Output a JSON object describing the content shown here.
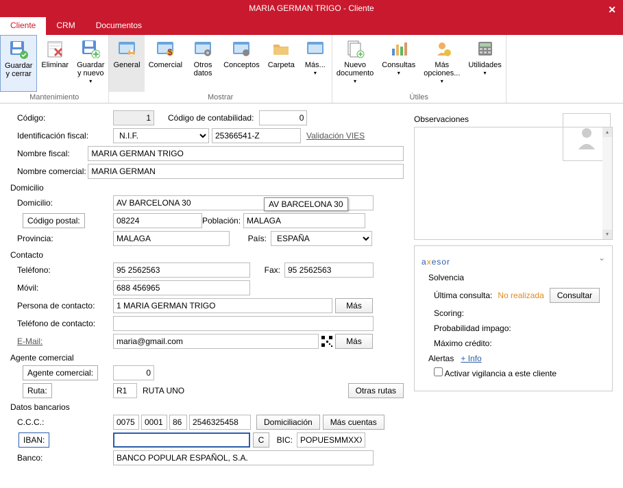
{
  "window": {
    "title": "MARIA GERMAN TRIGO - Cliente"
  },
  "tabs": {
    "cliente": "Cliente",
    "crm": "CRM",
    "documentos": "Documentos"
  },
  "ribbon": {
    "mantenimiento": {
      "label": "Mantenimiento",
      "guardar_cerrar": "Guardar\ny cerrar",
      "eliminar": "Eliminar",
      "guardar_nuevo": "Guardar\ny nuevo"
    },
    "mostrar": {
      "label": "Mostrar",
      "general": "General",
      "comercial": "Comercial",
      "otros": "Otros\ndatos",
      "conceptos": "Conceptos",
      "carpeta": "Carpeta",
      "mas": "Más..."
    },
    "utiles": {
      "label": "Útiles",
      "nuevo": "Nuevo\ndocumento",
      "consultas": "Consultas",
      "mas_opciones": "Más\nopciones...",
      "utilidades": "Utilidades"
    }
  },
  "fields": {
    "codigo_lbl": "Código:",
    "codigo": "1",
    "cod_cont_lbl": "Código de contabilidad:",
    "cod_cont": "0",
    "id_fiscal_lbl": "Identificación fiscal:",
    "nif_type": "N.I.F.",
    "nif": "25366541-Z",
    "vies": "Validación VIES",
    "nom_fiscal_lbl": "Nombre fiscal:",
    "nom_fiscal": "MARIA GERMAN TRIGO",
    "nom_com_lbl": "Nombre comercial:",
    "nom_com": "MARIA GERMAN",
    "domicilio_h": "Domicilio",
    "domicilio_lbl": "Domicilio:",
    "domicilio": "AV BARCELONA 30",
    "tooltip": "AV BARCELONA 30",
    "cp_btn": "Código postal:",
    "cp": "08224",
    "poblacion_lbl": "Población:",
    "poblacion": "MALAGA",
    "provincia_lbl": "Provincia:",
    "provincia": "MALAGA",
    "pais_lbl": "País:",
    "pais": "ESPAÑA",
    "contacto_h": "Contacto",
    "tel_lbl": "Teléfono:",
    "tel": "95 2562563",
    "fax_lbl": "Fax:",
    "fax": "95 2562563",
    "movil_lbl": "Móvil:",
    "movil": "688 456965",
    "persona_lbl": "Persona de contacto:",
    "persona": "1 MARIA GERMAN TRIGO",
    "mas_btn": "Más",
    "tel_cont_lbl": "Teléfono de contacto:",
    "tel_cont": "",
    "email_lbl": "E-Mail:",
    "email": "maria@gmail.com",
    "agente_h": "Agente comercial",
    "agente_btn": "Agente comercial:",
    "agente": "0",
    "ruta_btn": "Ruta:",
    "ruta_code": "R1",
    "ruta_name": "RUTA UNO",
    "otras_rutas": "Otras rutas",
    "bancarios_h": "Datos bancarios",
    "ccc_lbl": "C.C.C.:",
    "ccc1": "0075",
    "ccc2": "0001",
    "ccc3": "86",
    "ccc4": "2546325458",
    "domicil_btn": "Domiciliación",
    "mas_cuentas": "Más cuentas",
    "iban_lbl": "IBAN:",
    "iban": "",
    "c_btn": "C",
    "bic_lbl": "BIC:",
    "bic": "POPUESMMXXX",
    "banco_lbl": "Banco:",
    "banco": "BANCO POPULAR ESPAÑOL, S.A."
  },
  "obs": {
    "h": "Observaciones"
  },
  "axesor": {
    "brand": "axesor",
    "solvencia": "Solvencia",
    "ultima": "Última consulta:",
    "no_realizada": "No realizada",
    "consultar": "Consultar",
    "scoring": "Scoring:",
    "prob": "Probabilidad impago:",
    "max_cred": "Máximo crédito:",
    "alertas": "Alertas",
    "info": "+ Info",
    "vigilancia": "Activar vigilancia a este cliente"
  }
}
